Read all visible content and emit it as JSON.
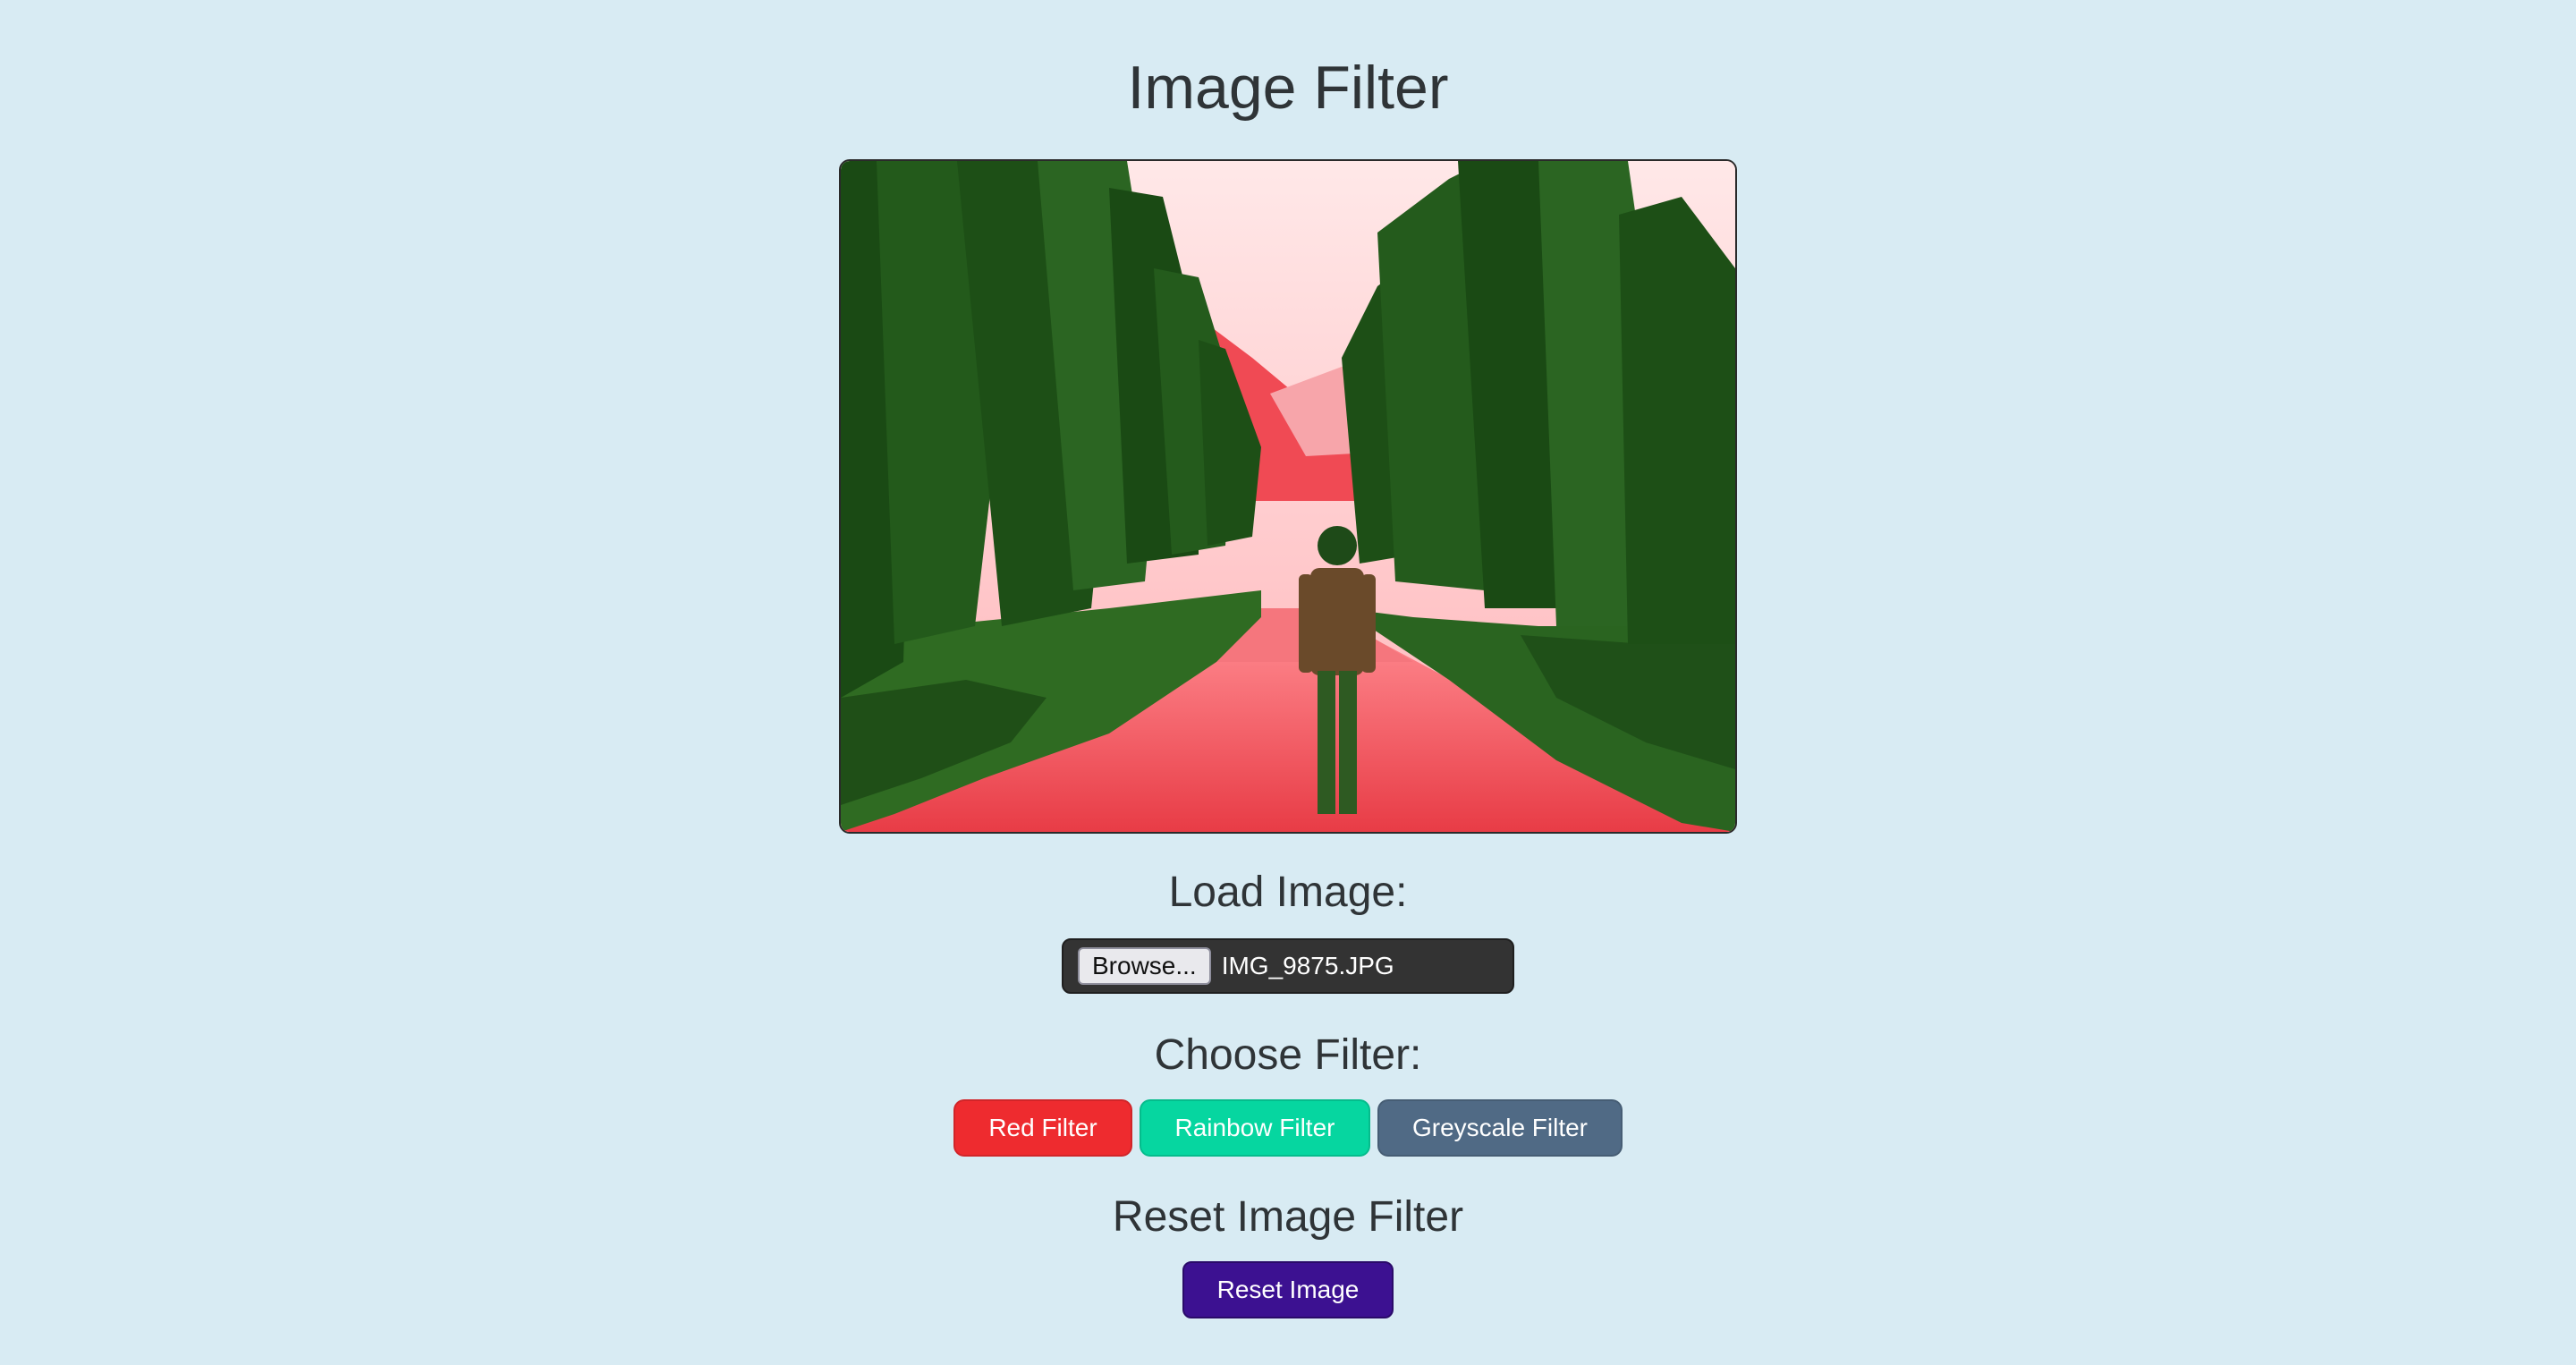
{
  "page": {
    "title": "Image Filter"
  },
  "image_preview": {
    "description_colors": {
      "sky": "#ffe4e4",
      "foliage": "#1e5a16",
      "path": "#f0505a"
    }
  },
  "load_section": {
    "heading": "Load Image:",
    "browse_label": "Browse...",
    "file_name": "IMG_9875.JPG"
  },
  "filter_section": {
    "heading": "Choose Filter:",
    "buttons": [
      {
        "label": "Red Filter",
        "color": "#ee2b2f"
      },
      {
        "label": "Rainbow Filter",
        "color": "#06d6a0"
      },
      {
        "label": "Greyscale Filter",
        "color": "#506a85"
      }
    ]
  },
  "reset_section": {
    "heading": "Reset Image Filter",
    "button_label": "Reset Image",
    "button_color": "#3c1191"
  },
  "colors": {
    "background": "#d8ebf3",
    "text": "#2f3437"
  }
}
